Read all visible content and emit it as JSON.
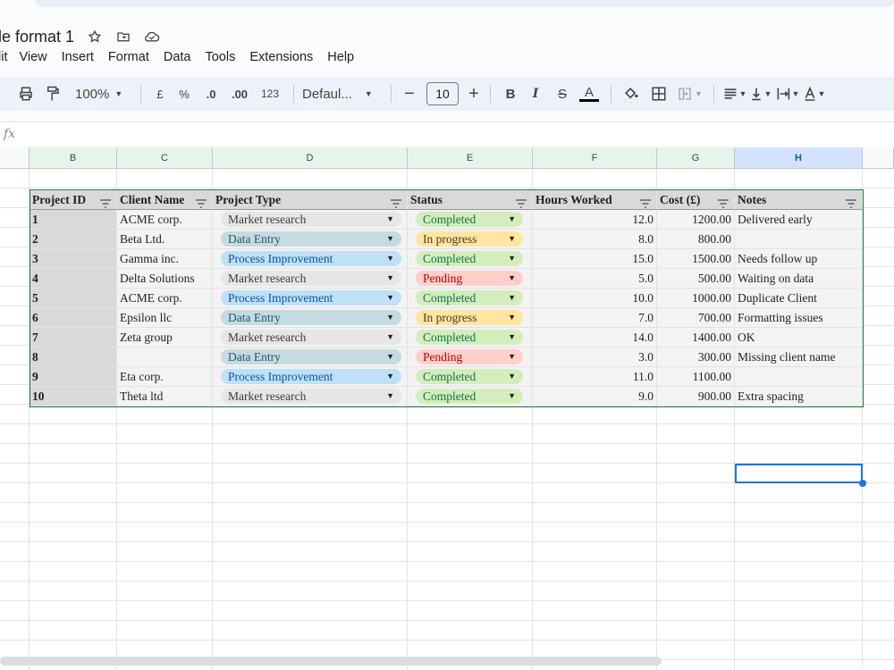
{
  "doc": {
    "title": "le format 1"
  },
  "menu": [
    "lit",
    "View",
    "Insert",
    "Format",
    "Data",
    "Tools",
    "Extensions",
    "Help"
  ],
  "toolbar": {
    "zoom": "100%",
    "currency": "£",
    "percent": "%",
    "dec_decrease": ".0",
    "dec_increase": ".00",
    "number_format": "123",
    "font": "Defaul...",
    "font_size": "10",
    "bold": "B",
    "italic": "I",
    "strike": "S",
    "text_color": "A"
  },
  "formula": {
    "fx": "fx"
  },
  "columns": [
    "B",
    "C",
    "D",
    "E",
    "F",
    "G",
    "H"
  ],
  "headers": [
    "Project ID",
    "Client Name",
    "Project Type",
    "Status",
    "Hours Worked",
    "Cost (£)",
    "Notes"
  ],
  "rows": [
    {
      "id": "1",
      "client": "ACME corp.",
      "type": "Market research",
      "status": "Completed",
      "hours": "12.0",
      "cost": "1200.00",
      "notes": "Delivered early"
    },
    {
      "id": "2",
      "client": "Beta Ltd.",
      "type": "Data Entry",
      "status": "In progress",
      "hours": "8.0",
      "cost": "800.00",
      "notes": ""
    },
    {
      "id": "3",
      "client": "Gamma inc.",
      "type": "Process Improvement",
      "status": "Completed",
      "hours": "15.0",
      "cost": "1500.00",
      "notes": "Needs follow up"
    },
    {
      "id": "4",
      "client": "Delta Solutions",
      "type": "Market research",
      "status": "Pending",
      "hours": "5.0",
      "cost": "500.00",
      "notes": "Waiting on data"
    },
    {
      "id": "5",
      "client": "ACME corp.",
      "type": "Process Improvement",
      "status": "Completed",
      "hours": "10.0",
      "cost": "1000.00",
      "notes": "Duplicate Client"
    },
    {
      "id": "6",
      "client": "Epsilon llc",
      "type": "Data Entry",
      "status": "In progress",
      "hours": "7.0",
      "cost": "700.00",
      "notes": "Formatting issues"
    },
    {
      "id": "7",
      "client": "Zeta group",
      "type": "Market research",
      "status": "Completed",
      "hours": "14.0",
      "cost": "1400.00",
      "notes": "OK"
    },
    {
      "id": "8",
      "client": "",
      "type": "Data Entry",
      "status": "Pending",
      "hours": "3.0",
      "cost": "300.00",
      "notes": "Missing client name"
    },
    {
      "id": "9",
      "client": "Eta corp.",
      "type": "Process Improvement",
      "status": "Completed",
      "hours": "11.0",
      "cost": "1100.00",
      "notes": ""
    },
    {
      "id": "10",
      "client": "Theta ltd",
      "type": "Market research",
      "status": "Completed",
      "hours": "9.0",
      "cost": "900.00",
      "notes": "Extra spacing"
    }
  ],
  "chip_colors": {
    "Market research": "#e6e6e6",
    "Data Entry": "#c6dbe1",
    "Process Improvement": "#bfe1f6",
    "Completed": "#d4edbc",
    "In progress": "#ffe5a0",
    "Pending": "#ffcfc9"
  },
  "chip_text_colors": {
    "Market research": "#3c3c3c",
    "Data Entry": "#215a6c",
    "Process Improvement": "#0a53a8",
    "Completed": "#11734b",
    "In progress": "#473821",
    "Pending": "#b10202"
  },
  "selected_column": "H"
}
